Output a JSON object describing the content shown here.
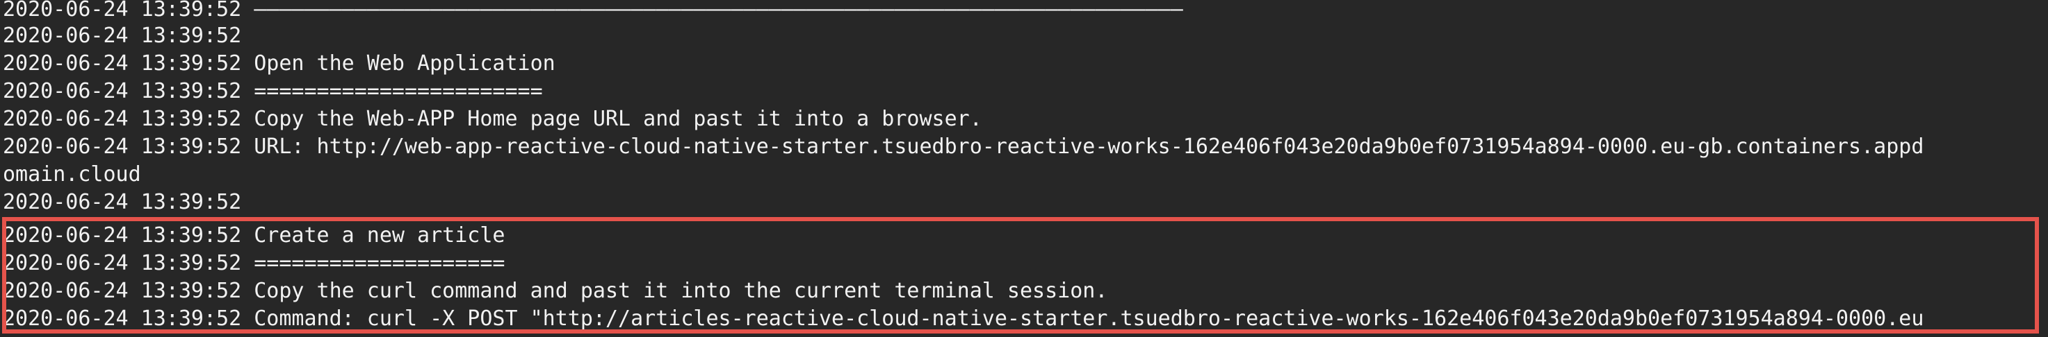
{
  "terminal": {
    "lines": [
      "2020-06-24 13:39:52 ——————————————————————————————————————————————————————————————————————————",
      "2020-06-24 13:39:52",
      "2020-06-24 13:39:52 Open the Web Application",
      "2020-06-24 13:39:52 =======================",
      "2020-06-24 13:39:52 Copy the Web-APP Home page URL and past it into a browser.",
      "2020-06-24 13:39:52 URL: http://web-app-reactive-cloud-native-starter.tsuedbro-reactive-works-162e406f043e20da9b0ef0731954a894-0000.eu-gb.containers.appd",
      "omain.cloud",
      "2020-06-24 13:39:52",
      "2020-06-24 13:39:52 Create a new article",
      "2020-06-24 13:39:52 ====================",
      "2020-06-24 13:39:52 Copy the curl command and past it into the current terminal session.",
      "2020-06-24 13:39:52 Command: curl -X POST \"http://articles-reactive-cloud-native-starter.tsuedbro-reactive-works-162e406f043e20da9b0ef0731954a894-0000.eu"
    ]
  },
  "highlight": {
    "color": "#e5534b"
  },
  "colors": {
    "background": "#272727",
    "text": "#f2f2f2"
  }
}
